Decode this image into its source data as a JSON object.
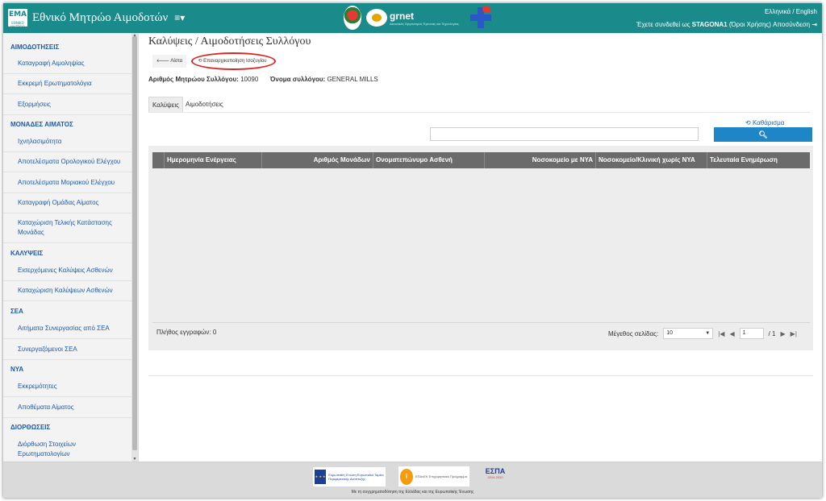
{
  "header": {
    "logo_text": "EMA",
    "logo_sub": "ΕΘΝΙΚΟ ΜΗΤΡΩΟ",
    "title": "Εθνικό Μητρώο Αιμοδοτών",
    "menu_icon": "hamburger-icon",
    "partner_logo_1": "ΣΚΕΑ",
    "partner_logo_2": "grnet",
    "partner_logo_2_sub": "Δικτυακός Οργανισμός Έρευνας και Τεχνολογίας",
    "language": "Ελληνικά / English",
    "session_prefix": "Έχετε συνδεθεί ως ",
    "session_user": "STAGONA1",
    "session_links": " (Όροι Χρήσης) Αποσύνδεση",
    "logout_icon": "logout-icon"
  },
  "sidebar": {
    "sections": [
      {
        "title": "ΑΙΜΟΔΟΤΗΣΕΙΣ",
        "items": [
          "Καταγραφή Αιμοληψίας",
          "Εκκρεμή Ερωτηματολόγια",
          "Εξορμήσεις"
        ]
      },
      {
        "title": "ΜΟΝΑΔΕΣ ΑΙΜΑΤΟΣ",
        "items": [
          "Ιχνηλασιμότητα",
          "Αποτελέσματα Ορολογικού Ελέγχου",
          "Αποτελέσματα Μοριακού Ελέγχου",
          "Καταγραφή Ομάδας Αίματος",
          "Καταχώριση Τελικής Κατάστασης Μονάδας"
        ]
      },
      {
        "title": "ΚΑΛΥΨΕΙΣ",
        "items": [
          "Εισερχόμενες Καλύψεις Ασθενών",
          "Καταχώριση Καλύψεων Ασθενών"
        ]
      },
      {
        "title": "ΣΕΑ",
        "items": [
          "Αιτήματα Συνεργασίας από ΣΕΑ",
          "Συνεργαζόμενοι ΣΕΑ"
        ]
      },
      {
        "title": "ΝΥΑ",
        "items": [
          "Εκκρεμότητες",
          "Αποθέματα Αίματος"
        ]
      },
      {
        "title": "ΔΙΟΡΘΩΣΕΙΣ",
        "items": [
          "Διόρθωση Στοιχείων Ερωτηματολογίων"
        ]
      }
    ]
  },
  "main": {
    "title": "Καλύψεις / Αιμοδοτήσεις Συλλόγου",
    "back_label": "Λίστα",
    "refresh_label": "Επαναρχικοποίηση Ισοζυγίου",
    "registry_label": "Αριθμός Μητρώου Συλλόγου:",
    "registry_value": " 10090",
    "name_label": "Όνομα συλλόγου:",
    "name_value": " GENERAL MILLS",
    "tabs": [
      "Καλύψεις",
      "Αιμοδοτήσεις"
    ],
    "clear_label": "Καθάρισμα",
    "search_value": "",
    "columns": [
      "",
      "Ημερομηνία Ενέργειας",
      "Αριθμός Μονάδων",
      "Ονοματεπώνυμο Ασθενή",
      "Νοσοκομείο με ΝΥΑ",
      "Νοσοκομείο/Κλινική χωρίς ΝΥΑ",
      "Τελευταία Ενημέρωση"
    ],
    "records_label": "Πλήθος εγγραφών: 0",
    "page_size_label": "Μέγεθος σελίδας:",
    "page_size": "10",
    "page_current": "1",
    "page_total": "/ 1"
  },
  "footer": {
    "eu_text": "Ευρωπαϊκή Ένωση Ευρωπαϊκό Ταμείο Περιφερειακής Ανάπτυξης",
    "epan_text": "ΕΠΑνΕΚ Επιχειρησιακό Πρόγραμμα",
    "espa_title": "ΕΣΠΑ",
    "espa_sub": "2014-2020",
    "note": "Με τη συγχρηματοδότηση της Ελλάδας και της Ευρωπαϊκής Ένωσης"
  }
}
